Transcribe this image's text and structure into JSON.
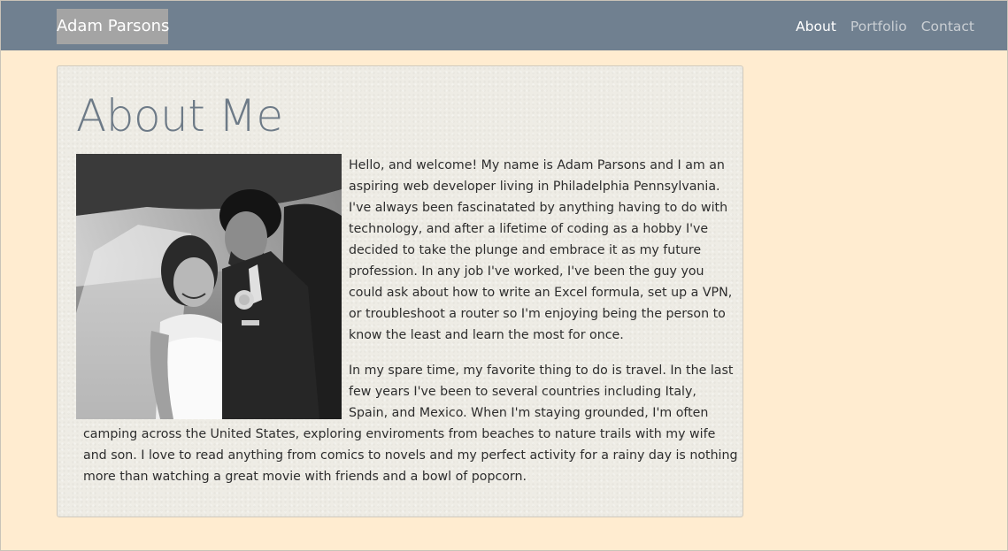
{
  "navbar": {
    "brand": "Adam Parsons",
    "links": [
      "About",
      "Portfolio",
      "Contact"
    ],
    "active": "About",
    "bg_color": "#708090"
  },
  "page": {
    "bg_color": "#ffecd0"
  },
  "about": {
    "heading": "About Me",
    "photo": "wedding-photo-black-and-white",
    "paragraph1": "Hello, and welcome! My name is Adam Parsons and I am an aspiring web developer living in Philadelphia Pennsylvania. I've always been fascinatated by anything having to do with technology, and after a lifetime of coding as a hobby I've decided to take the plunge and embrace it as my future profession. In any job I've worked, I've been the guy you could ask about how to write an Excel formula, set up a VPN, or troubleshoot a router so I'm enjoying being the person to know the least and learn the most for once.",
    "paragraph2_part1": "In my spare time, my favorite thing to do is travel. In the last few years I've been to several countries including Italy, Spain, and Mexico. When I'm staying grounded, I'm often",
    "paragraph2_part2": "camping across the United States, exploring enviroments from beaches to nature trails with my wife and son. I love to read anything from comics to novels and my perfect activity for a rainy day is nothing more than watching a great movie with friends and a bowl of popcorn."
  }
}
